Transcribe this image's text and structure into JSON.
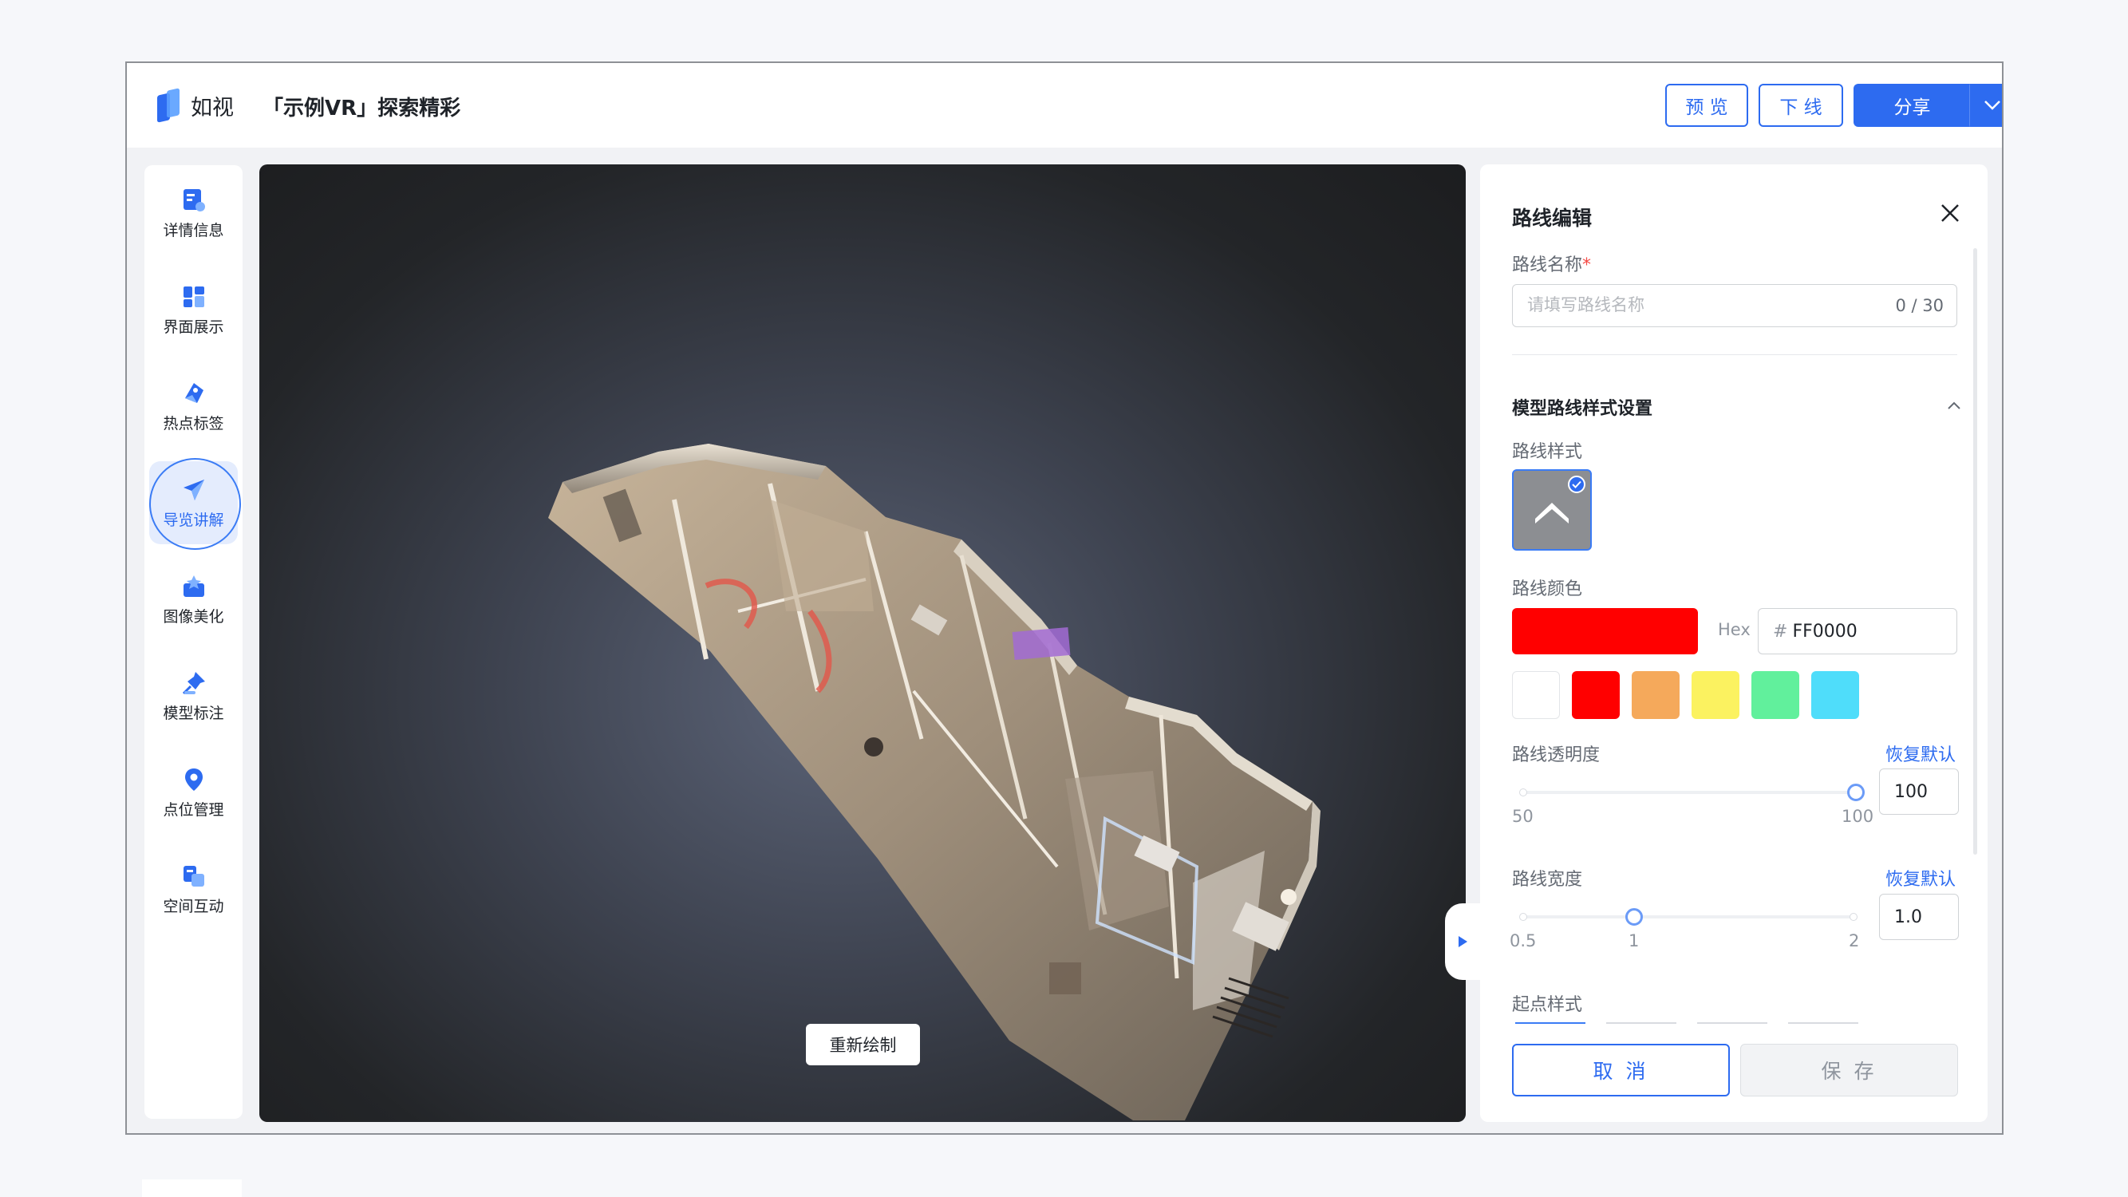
{
  "header": {
    "logo_text": "如视",
    "doc_title": "「示例VR」探索精彩",
    "preview_label": "预 览",
    "offline_label": "下 线",
    "share_label": "分享",
    "brand_color": "#2d6bf0"
  },
  "sidebar": {
    "items": [
      {
        "label": "详情信息",
        "icon": "info-card-icon"
      },
      {
        "label": "界面展示",
        "icon": "layout-grid-icon"
      },
      {
        "label": "热点标签",
        "icon": "tag-icon"
      },
      {
        "label": "导览讲解",
        "icon": "paper-plane-icon",
        "active": true
      },
      {
        "label": "图像美化",
        "icon": "image-enhance-icon"
      },
      {
        "label": "模型标注",
        "icon": "pushpin-icon"
      },
      {
        "label": "点位管理",
        "icon": "location-pin-icon"
      },
      {
        "label": "空间互动",
        "icon": "interaction-icon"
      }
    ]
  },
  "viewport": {
    "redraw_label": "重新绘制"
  },
  "panel": {
    "title": "路线编辑",
    "name_label": "路线名称",
    "required_mark": "*",
    "name_placeholder": "请填写路线名称",
    "name_value": "",
    "name_count": "0 / 30",
    "section_title": "模型路线样式设置",
    "style_label": "路线样式",
    "color_label": "路线颜色",
    "selected_color": "#FF0000",
    "hex_label": "Hex",
    "hex_hash": "#",
    "hex_value": "FF0000",
    "preset_colors": [
      "#FFFFFF",
      "#FF0000",
      "#F5A95B",
      "#FBF260",
      "#61F09C",
      "#4FDDFA"
    ],
    "opacity_label": "路线透明度",
    "opacity_reset": "恢复默认",
    "opacity_min": "50",
    "opacity_max": "100",
    "opacity_value": "100",
    "width_label": "路线宽度",
    "width_reset": "恢复默认",
    "width_ticks": [
      "0.5",
      "1",
      "2"
    ],
    "width_value": "1.0",
    "start_label": "起点样式",
    "cancel_label": "取 消",
    "save_label": "保 存"
  }
}
